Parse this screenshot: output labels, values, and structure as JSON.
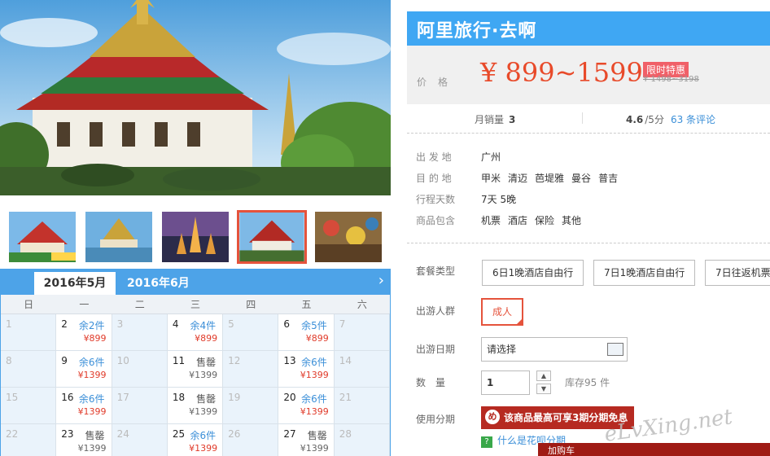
{
  "header_cut": "",
  "brand": "阿里旅行·去啊",
  "price": {
    "label": "价格",
    "range": "¥ 899~1599",
    "badge": "限时特惠",
    "original": "¥ 1498~3198"
  },
  "stats": {
    "sales_label": "月销量",
    "sales_value": "3",
    "rating_value": "4.6",
    "rating_suffix": "/5分",
    "reviews": "63 条评论"
  },
  "info": [
    {
      "key": "出 发 地",
      "values": [
        "广州"
      ]
    },
    {
      "key": "目 的 地",
      "values": [
        "甲米",
        "清迈",
        "芭堤雅",
        "曼谷",
        "普吉"
      ]
    },
    {
      "key": "行程天数",
      "values": [
        "7天 5晚"
      ]
    },
    {
      "key": "商品包含",
      "values": [
        "机票",
        "酒店",
        "保险",
        "其他"
      ]
    }
  ],
  "options": {
    "package_label": "套餐类型",
    "packages": [
      "6日1晚酒店自由行",
      "7日1晚酒店自由行",
      "7日往返机票"
    ],
    "group_label": "出游人群",
    "group_value": "成人",
    "date_label": "出游日期",
    "date_placeholder": "请选择",
    "qty_label": "数　量",
    "qty_value": "1",
    "stock": "库存95 件",
    "installment_label": "使用分期",
    "installment_banner": "该商品最高可享3期分期免息",
    "what_link": "什么是花呗分期",
    "red_panel_text": "加购车"
  },
  "watermark": "eLvXing.net",
  "calendar": {
    "tabs": [
      "2016年5月",
      "2016年6月"
    ],
    "weekdays": [
      "日",
      "一",
      "二",
      "三",
      "四",
      "五",
      "六"
    ],
    "cells": [
      {
        "d": "1"
      },
      {
        "d": "2",
        "s": "余2件",
        "p": "¥899"
      },
      {
        "d": "3"
      },
      {
        "d": "4",
        "s": "余4件",
        "p": "¥899"
      },
      {
        "d": "5"
      },
      {
        "d": "6",
        "s": "余5件",
        "p": "¥899"
      },
      {
        "d": "7"
      },
      {
        "d": "8"
      },
      {
        "d": "9",
        "s": "余6件",
        "p": "¥1399"
      },
      {
        "d": "10"
      },
      {
        "d": "11",
        "s": "售罄",
        "p": "¥1399",
        "sold": true
      },
      {
        "d": "12"
      },
      {
        "d": "13",
        "s": "余6件",
        "p": "¥1399"
      },
      {
        "d": "14"
      },
      {
        "d": "15"
      },
      {
        "d": "16",
        "s": "余6件",
        "p": "¥1399"
      },
      {
        "d": "17"
      },
      {
        "d": "18",
        "s": "售罄",
        "p": "¥1399",
        "sold": true
      },
      {
        "d": "19"
      },
      {
        "d": "20",
        "s": "余6件",
        "p": "¥1399"
      },
      {
        "d": "21"
      },
      {
        "d": "22"
      },
      {
        "d": "23",
        "s": "售罄",
        "p": "¥1399",
        "sold": true
      },
      {
        "d": "24"
      },
      {
        "d": "25",
        "s": "余6件",
        "p": "¥1399"
      },
      {
        "d": "26"
      },
      {
        "d": "27",
        "s": "售罄",
        "p": "¥1399",
        "sold": true
      },
      {
        "d": "28"
      }
    ]
  },
  "colors": {
    "accent": "#3fa7f3",
    "price": "#e84a2a",
    "selected": "#e5533c",
    "banner_dark": "#b62a21"
  }
}
